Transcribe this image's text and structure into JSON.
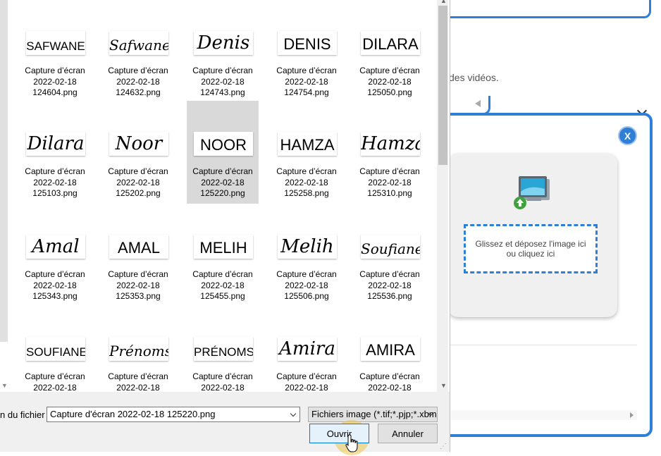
{
  "background": {
    "text_fragment": "des vidéos.",
    "close_label": "X",
    "drop_zone": {
      "line1": "Glissez et déposez l'image ici",
      "line2": "ou cliquez ici"
    },
    "accent_color": "#2f7fd6"
  },
  "file_dialog": {
    "files": [
      {
        "thumb": "SAFWANE",
        "style": "caps",
        "line1": "Capture d’écran",
        "line2": "2022-02-18",
        "line3": "124604.png"
      },
      {
        "thumb": "Safwane",
        "style": "cursive",
        "line1": "Capture d’écran",
        "line2": "2022-02-18",
        "line3": "124632.png"
      },
      {
        "thumb": "Denis",
        "style": "cursive",
        "line1": "Capture d’écran",
        "line2": "2022-02-18",
        "line3": "124743.png"
      },
      {
        "thumb": "DENIS",
        "style": "caps",
        "line1": "Capture d’écran",
        "line2": "2022-02-18",
        "line3": "124754.png"
      },
      {
        "thumb": "DILARA",
        "style": "caps",
        "line1": "Capture d’écran",
        "line2": "2022-02-18",
        "line3": "125050.png"
      },
      {
        "thumb": "Dilara",
        "style": "cursive",
        "line1": "Capture d’écran",
        "line2": "2022-02-18",
        "line3": "125103.png"
      },
      {
        "thumb": "Noor",
        "style": "cursive",
        "line1": "Capture d’écran",
        "line2": "2022-02-18",
        "line3": "125202.png"
      },
      {
        "thumb": "NOOR",
        "style": "caps",
        "line1": "Capture d’écran",
        "line2": "2022-02-18",
        "line3": "125220.png",
        "selected": true
      },
      {
        "thumb": "HAMZA",
        "style": "caps",
        "line1": "Capture d’écran",
        "line2": "2022-02-18",
        "line3": "125258.png"
      },
      {
        "thumb": "Hamza",
        "style": "cursive",
        "line1": "Capture d’écran",
        "line2": "2022-02-18",
        "line3": "125310.png"
      },
      {
        "thumb": "Amal",
        "style": "cursive",
        "line1": "Capture d’écran",
        "line2": "2022-02-18",
        "line3": "125343.png"
      },
      {
        "thumb": "AMAL",
        "style": "caps",
        "line1": "Capture d’écran",
        "line2": "2022-02-18",
        "line3": "125353.png"
      },
      {
        "thumb": "MELIH",
        "style": "caps",
        "line1": "Capture d’écran",
        "line2": "2022-02-18",
        "line3": "125455.png"
      },
      {
        "thumb": "Melih",
        "style": "cursive",
        "line1": "Capture d’écran",
        "line2": "2022-02-18",
        "line3": "125506.png"
      },
      {
        "thumb": "Soufiane",
        "style": "cursive",
        "line1": "Capture d’écran",
        "line2": "2022-02-18",
        "line3": "125536.png"
      },
      {
        "thumb": "SOUFIANE",
        "style": "caps",
        "line1": "Capture d’écran",
        "line2": "2022-02-18",
        "line3": ""
      },
      {
        "thumb": "Prénoms",
        "style": "cursive",
        "line1": "Capture d’écran",
        "line2": "2022-02-18",
        "line3": ""
      },
      {
        "thumb": "PRÉNOMS",
        "style": "caps",
        "line1": "Capture d’écran",
        "line2": "2022-02-18",
        "line3": ""
      },
      {
        "thumb": "Amira",
        "style": "cursive",
        "line1": "Capture d’écran",
        "line2": "2022-02-18",
        "line3": ""
      },
      {
        "thumb": "AMIRA",
        "style": "caps",
        "line1": "Capture d’écran",
        "line2": "2022-02-18",
        "line3": ""
      }
    ],
    "filename_label": "n du fichier :",
    "filename_value": "Capture d'écran 2022-02-18 125220.png",
    "filetype_value": "Fichiers image (*.tif;*.pjp;*.xbm;*",
    "open_label": "Ouvrir",
    "cancel_label": "Annuler",
    "selection_color": "#d9d9d9"
  }
}
